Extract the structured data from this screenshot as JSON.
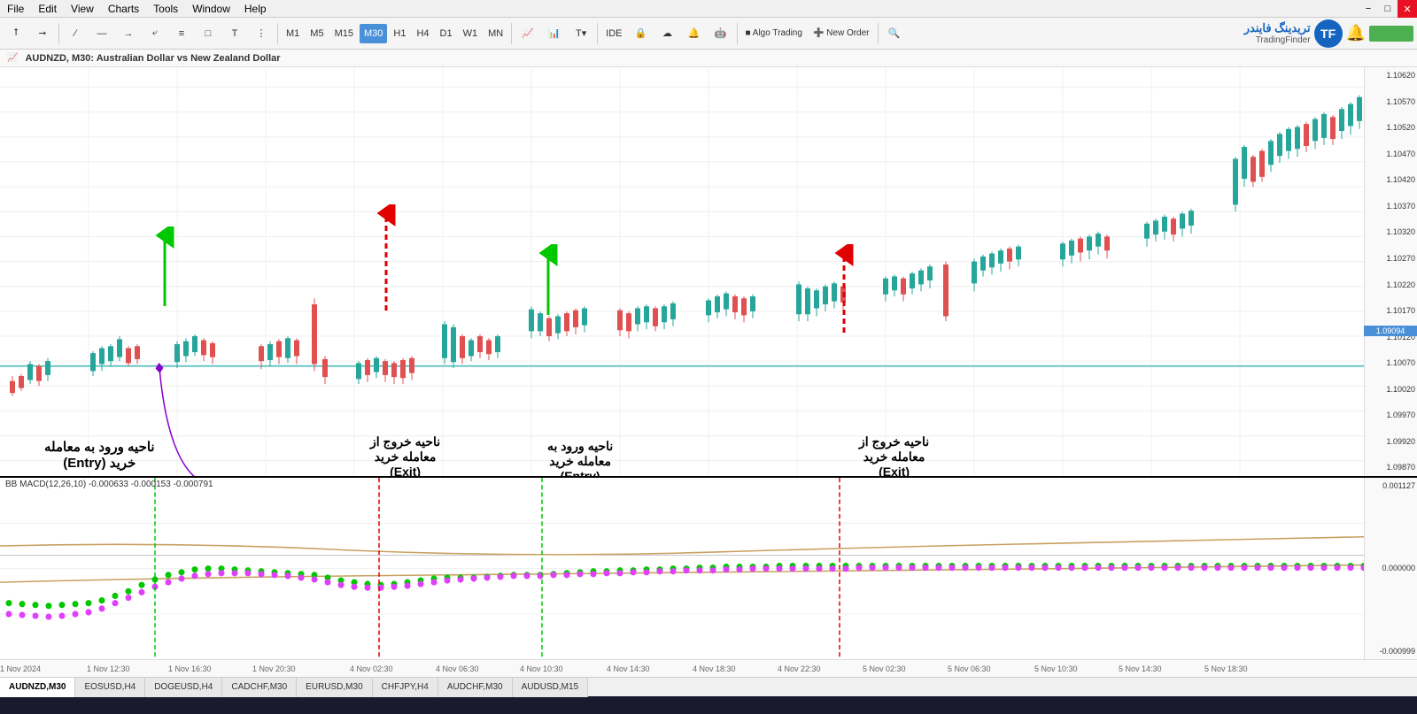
{
  "menubar": {
    "items": [
      "File",
      "Edit",
      "View",
      "Charts",
      "Tools",
      "Window",
      "Help"
    ]
  },
  "toolbar": {
    "timeframes": [
      "M1",
      "M5",
      "M15",
      "M30",
      "H1",
      "H4",
      "D1",
      "W1",
      "MN"
    ],
    "active_timeframe": "M30",
    "buttons": [
      "cursor",
      "crosshair",
      "line",
      "hline",
      "ray",
      "polyline",
      "channel",
      "text",
      "shapes",
      "more"
    ],
    "right_buttons": [
      "IDE",
      "lock",
      "cloud",
      "alert",
      "algo-trading",
      "new-order",
      "arrows",
      "levels",
      "waves",
      "zoom"
    ]
  },
  "chart": {
    "title": "AUDNZD, M30:  Australian Dollar vs New Zealand Dollar",
    "symbol": "AUDNZD",
    "timeframe": "M30",
    "indicator": "BB MACD(12,26,10)  -0.000633  -0.000153  -0.000791",
    "price_levels": [
      "1.10620",
      "1.10570",
      "1.10520",
      "1.10470",
      "1.10420",
      "1.10370",
      "1.10320",
      "1.10270",
      "1.10220",
      "1.10170",
      "1.10120",
      "1.10070",
      "1.10020",
      "1.09970",
      "1.09920",
      "1.09870"
    ],
    "current_price": "1.09094",
    "macd_levels": [
      "0.001127",
      "0.000000",
      "-0.000999"
    ],
    "time_labels": [
      "1 Nov 2024",
      "1 Nov 12:30",
      "1 Nov 16:30",
      "1 Nov 20:30",
      "4 Nov 02:30",
      "4 Nov 06:30",
      "4 Nov 10:30",
      "4 Nov 14:30",
      "4 Nov 18:30",
      "4 Nov 22:30",
      "5 Nov 02:30",
      "5 Nov 06:30",
      "5 Nov 10:30",
      "5 Nov 14:30",
      "5 Nov 18:30"
    ]
  },
  "annotations": [
    {
      "id": "entry1",
      "label_fa": "ناحیه ورود به معامله",
      "label_fa2": "خرید (Entry)",
      "color": "green",
      "type": "up-solid"
    },
    {
      "id": "exit1",
      "label_fa": "ناحیه خروج از",
      "label_fa2": "معامله خرید",
      "label_fa3": "(Exit)",
      "color": "red",
      "type": "up-dashed"
    },
    {
      "id": "entry2",
      "label_fa": "ناحیه ورود به",
      "label_fa2": "معامله خرید",
      "label_fa3": "(Entry)",
      "color": "green",
      "type": "up-solid"
    },
    {
      "id": "exit2",
      "label_fa": "ناحیه خروج از",
      "label_fa2": "معامله خرید",
      "label_fa3": "(Exit)",
      "color": "red",
      "type": "up-dashed"
    }
  ],
  "logo": {
    "text": "تریدینگ فایندر",
    "subtext": "TradingFinder"
  },
  "tabs": [
    "AUDNZD,M30",
    "EOSUSD,H4",
    "DOGEUSD,H4",
    "CADCHF,M30",
    "EURUSD,M30",
    "CHFJPY,H4",
    "AUDCHF,M30",
    "AUDUSD,M15"
  ]
}
